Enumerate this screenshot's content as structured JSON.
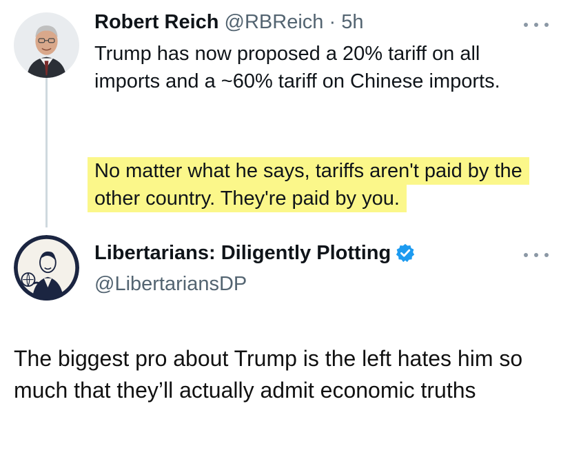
{
  "tweet_original": {
    "display_name": "Robert Reich",
    "handle": "@RBReich",
    "separator": "·",
    "time": "5h",
    "text_p1": "Trump has now proposed a 20% tariff on all imports and a ~60% tariff on Chinese imports.",
    "text_p2": "No matter what he says, tariffs aren't paid by the other country. They're paid by you.",
    "avatar_icon": "portrait-photo-avatar",
    "more_icon": "more-options-icon"
  },
  "tweet_reply": {
    "display_name": "Libertarians: Diligently Plotting",
    "handle": "@LibertariansDP",
    "verified_icon": "verified-badge-icon",
    "avatar_icon": "illustrated-man-avatar",
    "more_icon": "more-options-icon"
  },
  "comment": {
    "text": "The biggest pro about Trump is the left hates him so much that they’ll actually admit economic truths"
  },
  "colors": {
    "highlight": "#fbf78a",
    "verified": "#1d9bf0",
    "muted_text": "#536471",
    "thread_line": "#cfd9de"
  }
}
